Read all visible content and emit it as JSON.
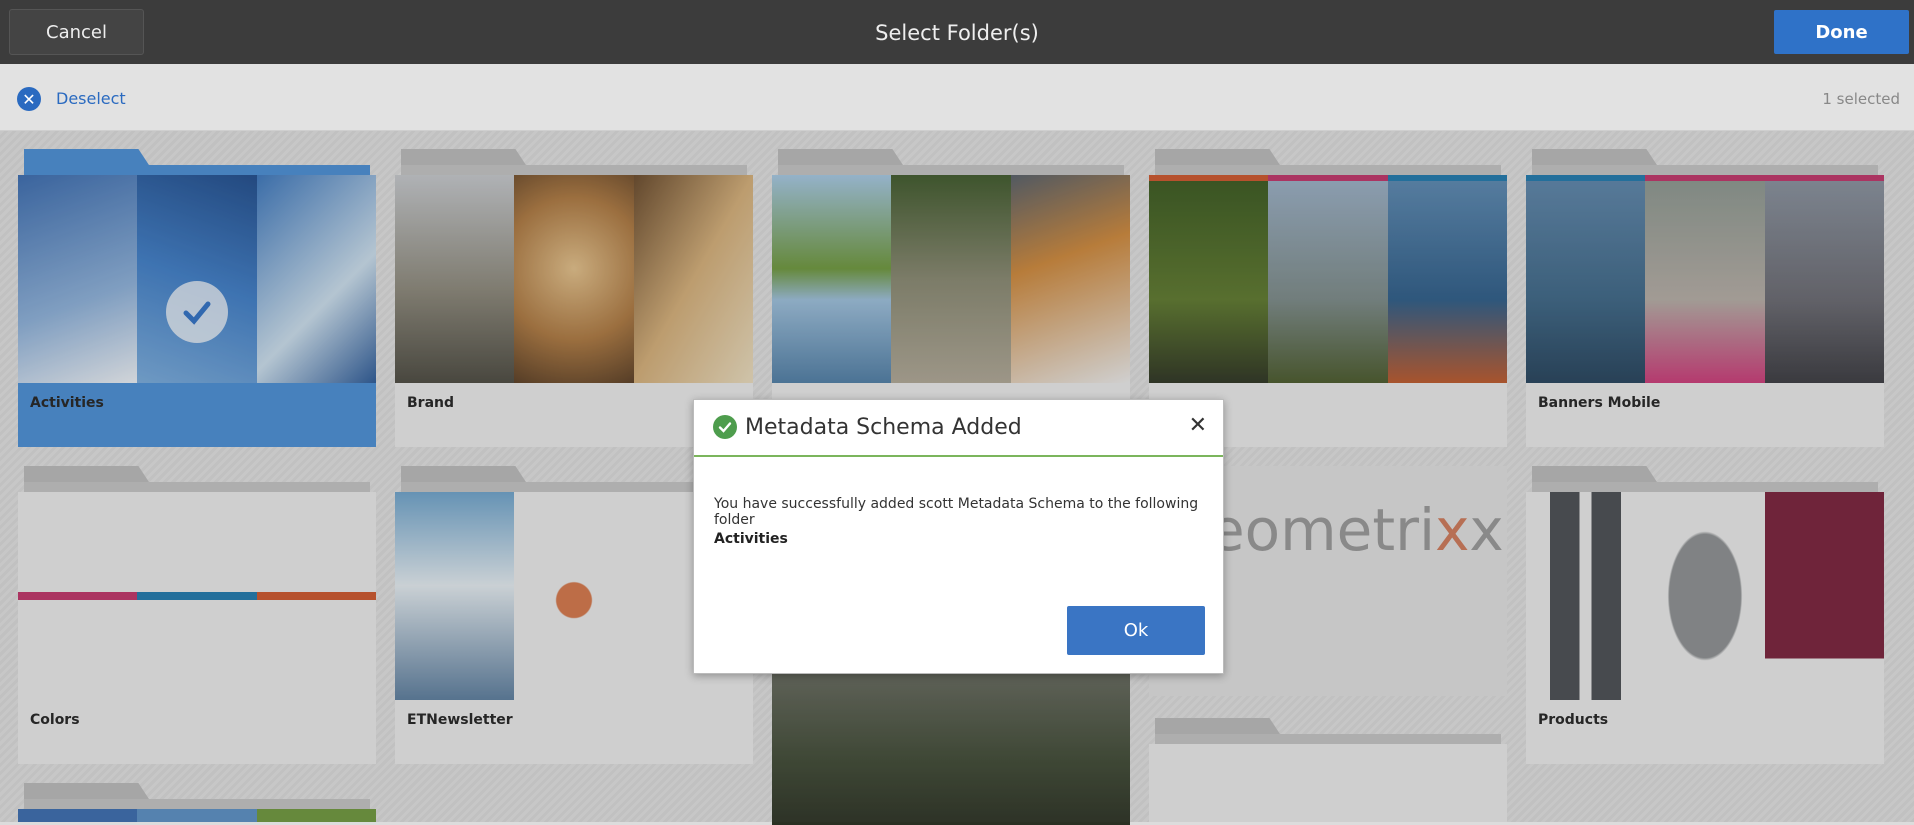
{
  "header": {
    "cancel_label": "Cancel",
    "title": "Select Folder(s)",
    "done_label": "Done"
  },
  "selection_bar": {
    "deselect_label": "Deselect",
    "selected_count": "1 selected"
  },
  "folders": [
    {
      "name": "Activities",
      "selected": true
    },
    {
      "name": "Brand",
      "selected": false
    },
    {
      "name": "",
      "selected": false
    },
    {
      "name": "",
      "selected": false
    },
    {
      "name": "Banners Mobile",
      "selected": false
    },
    {
      "name": "Colors",
      "selected": false
    },
    {
      "name": "ETNewsletter",
      "selected": false
    },
    {
      "name": "Products",
      "selected": false
    }
  ],
  "dialog": {
    "title": "Metadata Schema Added",
    "message": "You have successfully added scott Metadata Schema to the following folder",
    "folder": "Activities",
    "ok_label": "Ok"
  },
  "colors": {
    "header_bg": "#3c3c3c",
    "accent_blue": "#2f72c8",
    "selected_card": "#4a90d9",
    "success_green": "#4e9d4d"
  }
}
